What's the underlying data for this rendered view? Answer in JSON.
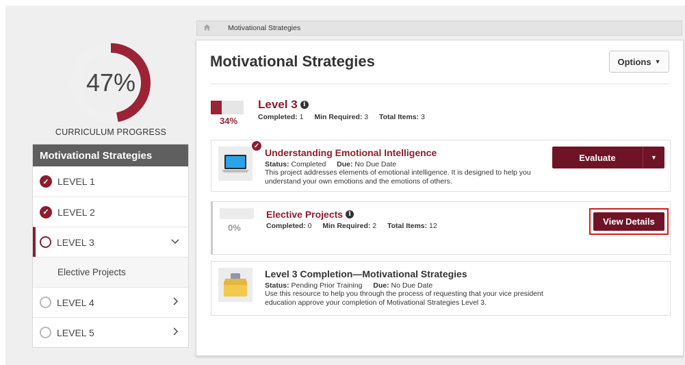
{
  "progress": {
    "percent_label": "47%",
    "fraction": 0.47,
    "caption": "CURRICULUM PROGRESS",
    "ring_color": "#9b2335",
    "track_color": "#f0f0f0"
  },
  "sidebar": {
    "title": "Motivational Strategies",
    "items": [
      {
        "label": "LEVEL 1",
        "state": "completed"
      },
      {
        "label": "LEVEL 2",
        "state": "completed"
      },
      {
        "label": "LEVEL 3",
        "state": "active"
      },
      {
        "label": "Elective Projects",
        "state": "sub"
      },
      {
        "label": "LEVEL 4",
        "state": "locked"
      },
      {
        "label": "LEVEL 5",
        "state": "locked"
      }
    ]
  },
  "breadcrumb": {
    "home_icon": "home-icon",
    "current": "Motivational Strategies"
  },
  "main": {
    "title": "Motivational Strategies",
    "options_label": "Options",
    "level": {
      "title": "Level 3",
      "percent_label": "34%",
      "fraction": 0.34,
      "completed_label": "Completed:",
      "completed": "1",
      "min_label": "Min Required:",
      "min": "3",
      "total_label": "Total Items:",
      "total": "3"
    },
    "cards": {
      "ei": {
        "title": "Understanding Emotional Intelligence",
        "status_label": "Status:",
        "status": "Completed",
        "due_label": "Due:",
        "due": "No Due Date",
        "description": "This project addresses elements of emotional intelligence. It is designed to help you understand your own emotions and the emotions of others.",
        "button": "Evaluate"
      },
      "elective": {
        "title": "Elective Projects",
        "percent_label": "0%",
        "completed_label": "Completed:",
        "completed": "0",
        "min_label": "Min Required:",
        "min": "2",
        "total_label": "Total Items:",
        "total": "12",
        "button": "View Details"
      },
      "completion": {
        "title": "Level 3 Completion—Motivational Strategies",
        "status_label": "Status:",
        "status": "Pending Prior Training",
        "due_label": "Due:",
        "due": "No Due Date",
        "description": "Use this resource to help you through the process of requesting that your vice president education approve your completion of Motivational Strategies Level 3."
      }
    }
  },
  "colors": {
    "brand": "#8c1d2e",
    "button": "#6e1426",
    "highlight": "#d01d1d"
  }
}
